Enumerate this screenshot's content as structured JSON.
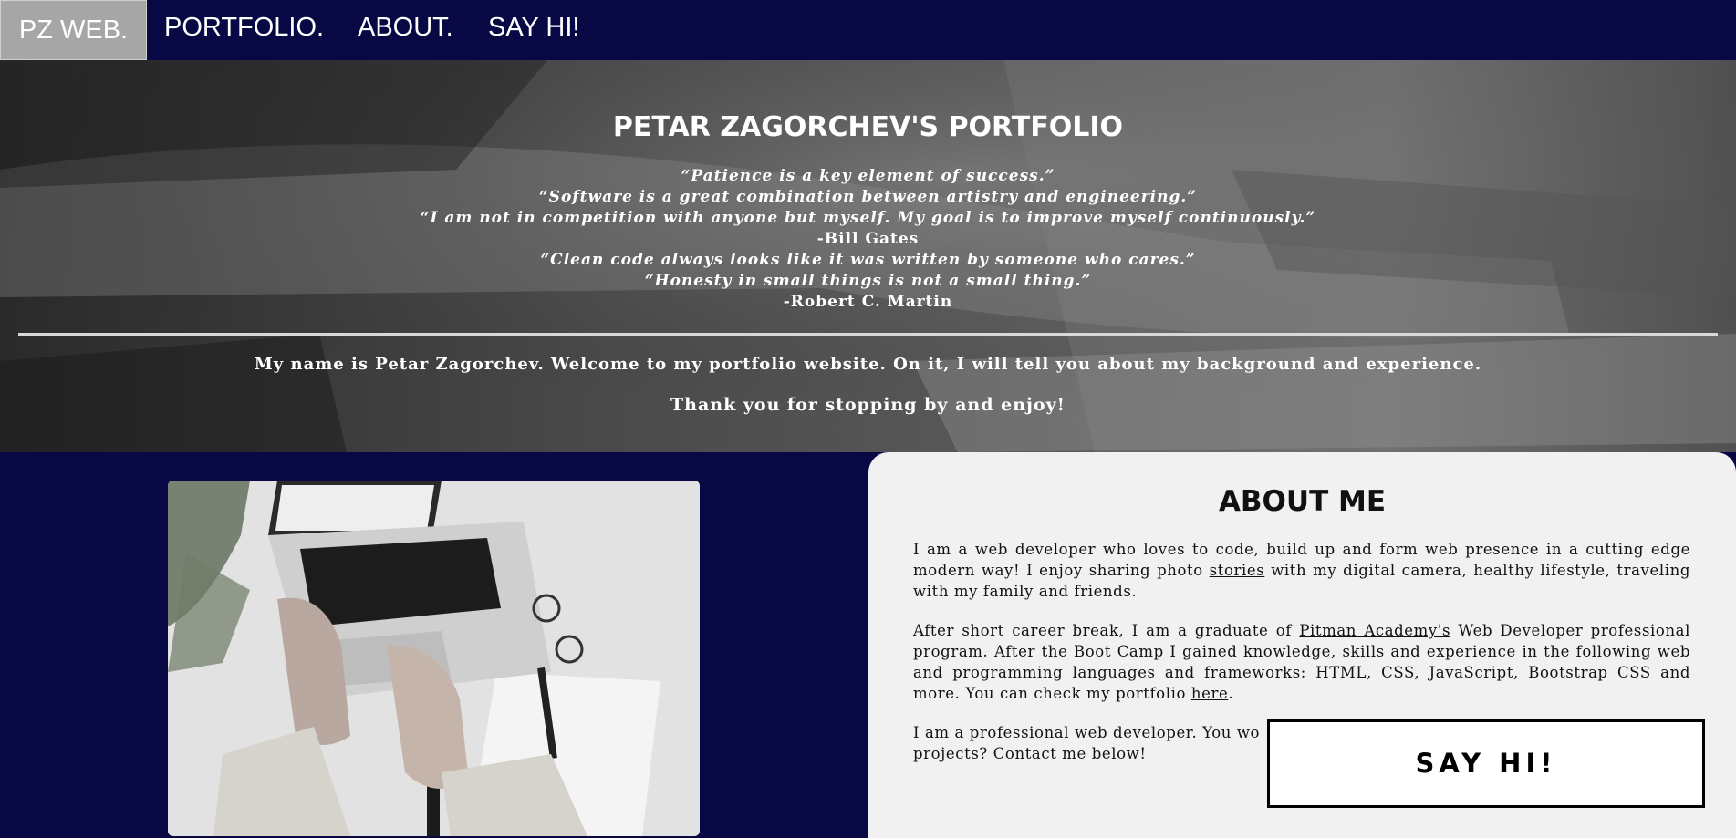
{
  "nav": {
    "brand": "PZ WEB.",
    "links": [
      "PORTFOLIO.",
      "ABOUT.",
      "SAY HI!"
    ]
  },
  "hero": {
    "title": "PETAR ZAGORCHEV'S PORTFOLIO",
    "quotes": [
      "“Patience is a key element of success.”",
      "“Software is a great combination between artistry and engineering.”",
      "“I am not in competition with anyone but myself. My goal is to improve myself continuously.”"
    ],
    "author1": "-Bill Gates",
    "quotes2": [
      "“Clean code always looks like it was written by someone who cares.”",
      "“Honesty in small things is not a small thing.”"
    ],
    "author2": "-Robert C. Martin",
    "intro": "My name is Petar Zagorchev. Welcome to my portfolio website. On it, I will tell you about my background and experience.",
    "thanks": "Thank you for stopping by and enjoy!"
  },
  "about": {
    "title": "ABOUT ME",
    "p1_before": "I am a web developer who loves to code, build up and form web presence in a cutting edge modern way! I enjoy sharing photo ",
    "p1_link": "stories",
    "p1_after": " with my digital camera, healthy lifestyle, traveling with my family and friends.",
    "p2_before": "After short career break, I am a graduate of ",
    "p2_link": "Pitman Academy's",
    "p2_mid": " Web Developer professional program. After the Boot Camp I gained knowledge, skills and experience in the following web and programming languages and frameworks: HTML, CSS, JavaScript, Bootstrap CSS and more. You can check my portfolio ",
    "p2_link2": "here",
    "p2_after": ".",
    "p3_before": "I am a professional web developer. You wo",
    "p3_line2": "projects? ",
    "p3_link": "Contact me",
    "p3_after": " below!"
  },
  "sayhi": {
    "label": "SAY HI!"
  }
}
